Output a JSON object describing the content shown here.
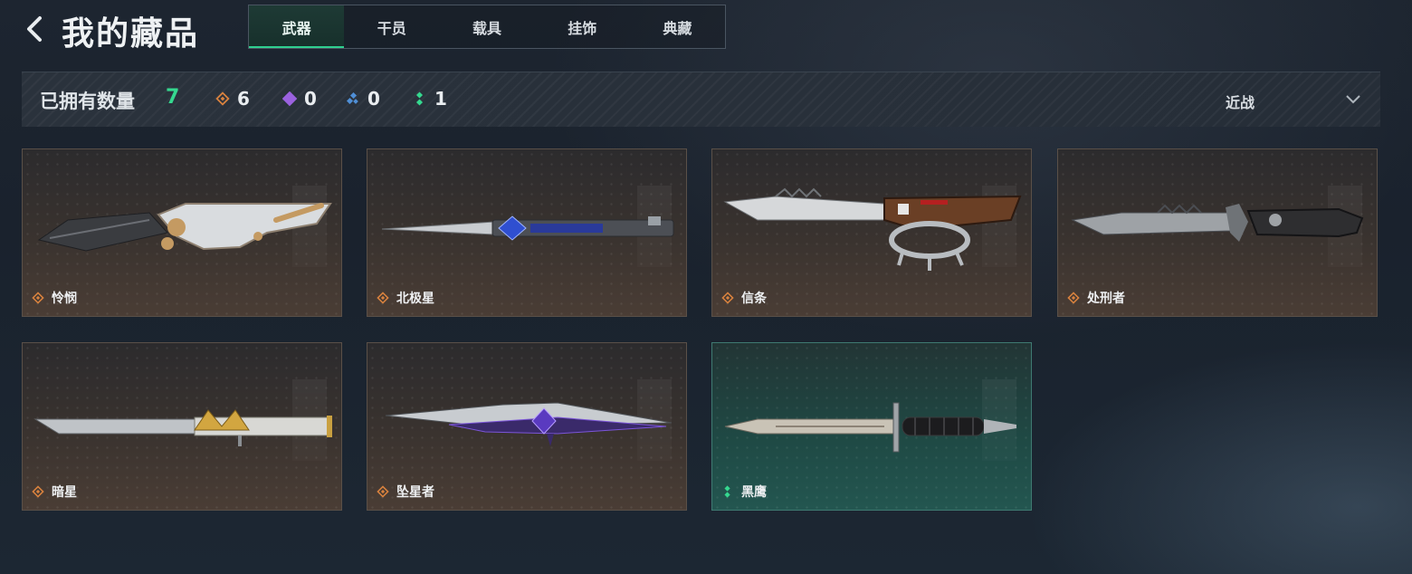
{
  "header": {
    "title": "我的藏品",
    "tabs": [
      {
        "label": "武器",
        "active": true
      },
      {
        "label": "干员",
        "active": false
      },
      {
        "label": "载具",
        "active": false
      },
      {
        "label": "挂饰",
        "active": false
      },
      {
        "label": "典藏",
        "active": false
      }
    ]
  },
  "stats": {
    "owned_label": "已拥有数量",
    "owned_count": "7",
    "rarity_counts": [
      {
        "icon": "orange-diamond-icon",
        "color": "#d9823e",
        "count": "6"
      },
      {
        "icon": "purple-diamond-icon",
        "color": "#9b62e0",
        "count": "0"
      },
      {
        "icon": "blue-diamond-icon",
        "color": "#4f8fd6",
        "count": "0"
      },
      {
        "icon": "green-dots-icon",
        "color": "#35d88f",
        "count": "1"
      }
    ],
    "filter_label": "近战"
  },
  "colors": {
    "accent": "#2fd08f",
    "orange": "#d9823e"
  },
  "items": [
    {
      "name": "怜悯",
      "rarity_icon": "orange-diamond-icon"
    },
    {
      "name": "北极星",
      "rarity_icon": "orange-diamond-icon"
    },
    {
      "name": "信条",
      "rarity_icon": "orange-diamond-icon"
    },
    {
      "name": "处刑者",
      "rarity_icon": "orange-diamond-icon"
    },
    {
      "name": "暗星",
      "rarity_icon": "orange-diamond-icon"
    },
    {
      "name": "坠星者",
      "rarity_icon": "orange-diamond-icon"
    },
    {
      "name": "黑鹰",
      "rarity_icon": "green-dots-icon",
      "selected": true
    }
  ]
}
